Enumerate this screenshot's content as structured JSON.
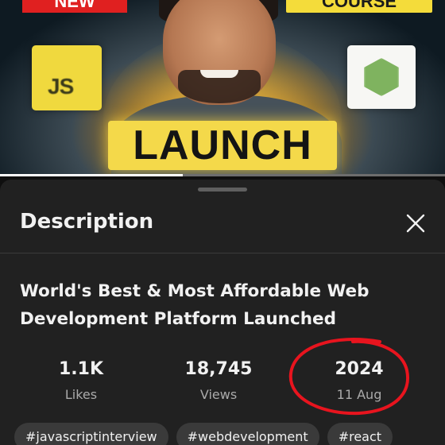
{
  "video": {
    "badge_left": "NEW",
    "badge_right": "COURSE",
    "js_logo_text": "JS",
    "banner_text": "LAUNCH",
    "progress": 0.41
  },
  "sheet": {
    "title": "Description",
    "video_title": "World's Best & Most Affordable Web Development Platform Launched",
    "stats": [
      {
        "value": "1.1K",
        "label": "Likes"
      },
      {
        "value": "18,745",
        "label": "Views"
      },
      {
        "value": "2024",
        "label": "11 Aug"
      }
    ],
    "hashtags": [
      "#javascriptinterview",
      "#webdevelopment",
      "#react"
    ],
    "annotation_color": "#e8141e"
  }
}
